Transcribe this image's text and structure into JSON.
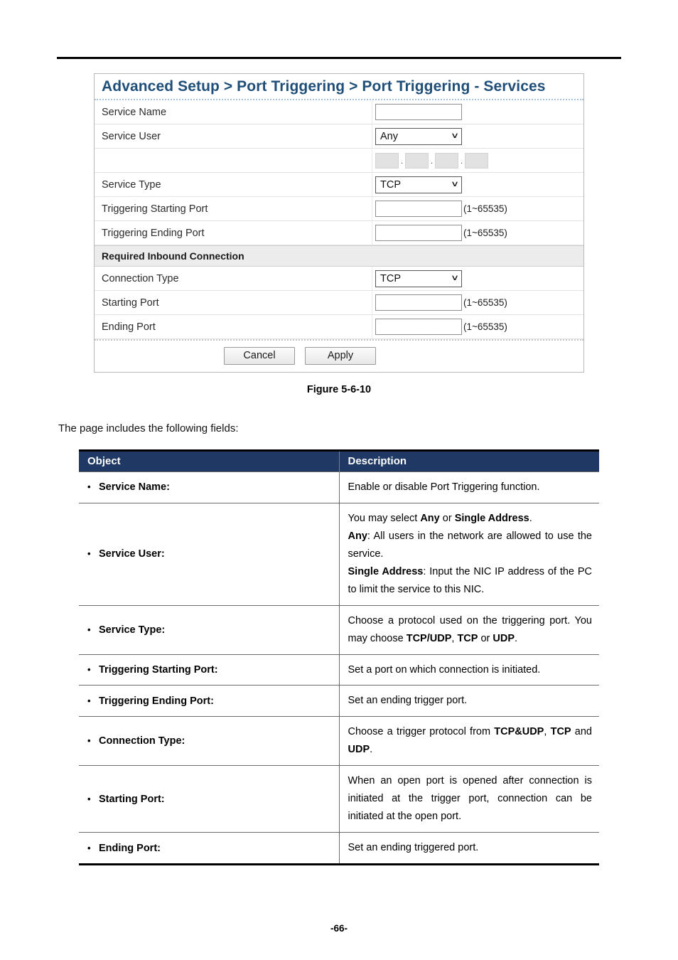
{
  "page": {
    "footer": "-66-",
    "intro_text": "The page includes the following fields:",
    "figure_caption": "Figure 5-6-10"
  },
  "screenshot": {
    "title": "Advanced Setup > Port Triggering > Port Triggering - Services",
    "rows": [
      {
        "label": "Service Name",
        "control": "text",
        "value": "",
        "hint": ""
      },
      {
        "label": "Service User",
        "control": "select",
        "value": "Any",
        "hint": ""
      },
      {
        "label": "",
        "control": "ip",
        "value": "",
        "hint": ""
      },
      {
        "label": "Service Type",
        "control": "select",
        "value": "TCP",
        "hint": ""
      },
      {
        "label": "Triggering Starting Port",
        "control": "text",
        "value": "",
        "hint": "(1~65535)"
      },
      {
        "label": "Triggering Ending Port",
        "control": "text",
        "value": "",
        "hint": "(1~65535)"
      }
    ],
    "section_header": "Required Inbound Connection",
    "rows2": [
      {
        "label": "Connection Type",
        "control": "select",
        "value": "TCP",
        "hint": ""
      },
      {
        "label": "Starting Port",
        "control": "text",
        "value": "",
        "hint": "(1~65535)"
      },
      {
        "label": "Ending Port",
        "control": "text",
        "value": "",
        "hint": "(1~65535)"
      }
    ],
    "buttons": {
      "cancel": "Cancel",
      "apply": "Apply"
    },
    "ip_separator": ".",
    "chevron": "∨",
    "colors": {
      "title": "#1f4e79",
      "section_bg": "#ececec",
      "octet_bg": "#e2e2e2"
    }
  },
  "table": {
    "headers": {
      "object": "Object",
      "description": "Description"
    },
    "header_bg": "#1f3864",
    "bullet": "•",
    "rows": [
      {
        "object": "Service Name:",
        "desc_html": "Enable or disable Port Triggering function."
      },
      {
        "object": "Service User:",
        "desc_html": "<p>You may select <b>Any</b> or <b>Single Address</b>.</p><p><b>Any</b>: All users in the network are allowed to use the service.</p><p><b>Single Address</b>: Input the NIC IP address of the PC to limit the service to this NIC.</p>"
      },
      {
        "object": "Service Type:",
        "desc_html": "Choose a protocol used on the triggering port. You may choose <b>TCP/UDP</b>, <b>TCP</b> or <b>UDP</b>."
      },
      {
        "object": "Triggering Starting Port:",
        "desc_html": "Set a port on which connection is initiated."
      },
      {
        "object": "Triggering Ending Port:",
        "desc_html": "Set an ending trigger port."
      },
      {
        "object": "Connection Type:",
        "desc_html": "Choose a trigger protocol from <b>TCP&amp;UDP</b>, <b>TCP</b> and <b>UDP</b>."
      },
      {
        "object": "Starting Port:",
        "desc_html": "When an open port is opened after connection is initiated at the trigger port, connection can be initiated at the open port."
      },
      {
        "object": "Ending Port:",
        "desc_html": "Set an ending triggered port."
      }
    ]
  }
}
